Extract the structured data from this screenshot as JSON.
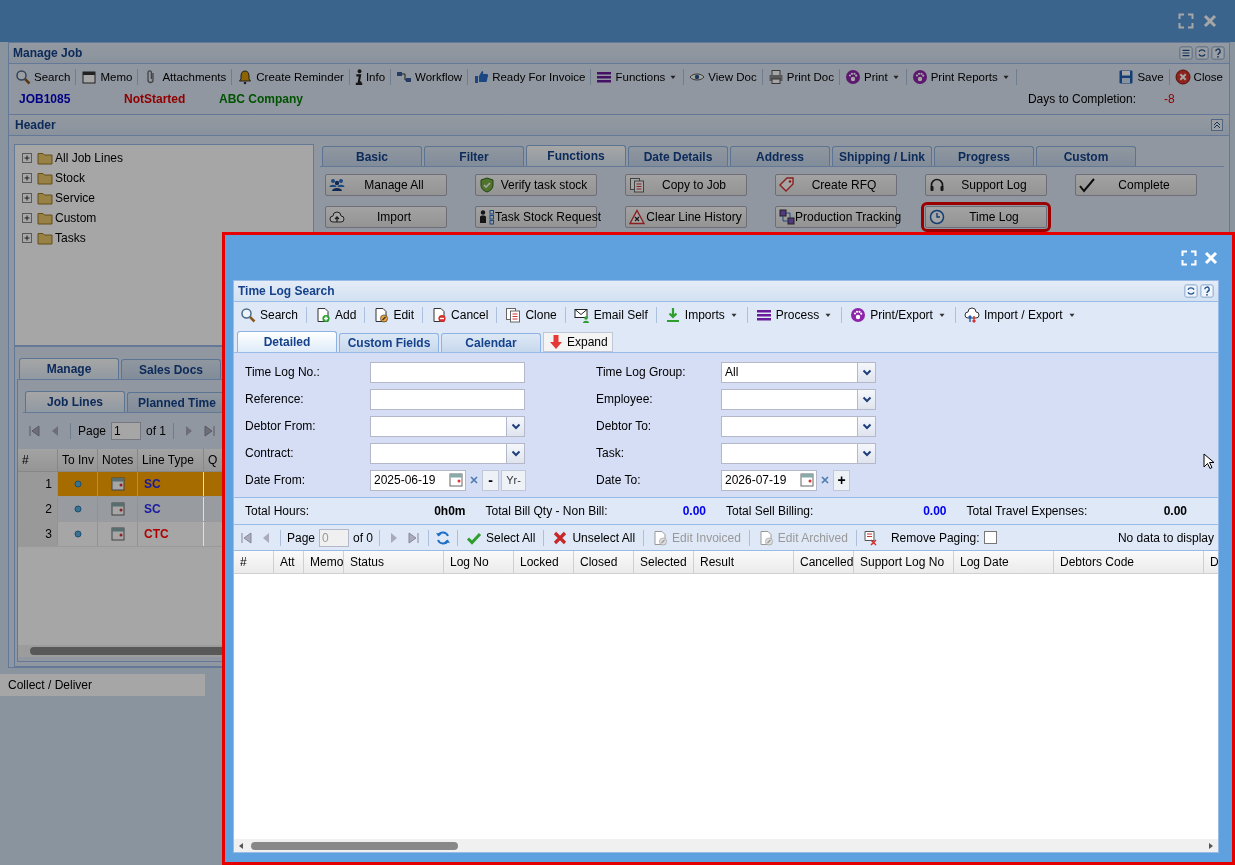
{
  "manage_job": {
    "title": "Manage Job",
    "toolbar": [
      {
        "label": "Search",
        "dropdown": false
      },
      {
        "label": "Memo",
        "dropdown": false
      },
      {
        "label": "Attachments",
        "dropdown": false
      },
      {
        "label": "Create Reminder",
        "dropdown": false
      },
      {
        "label": "Info",
        "dropdown": false
      },
      {
        "label": "Workflow",
        "dropdown": false
      },
      {
        "label": "Ready For Invoice",
        "dropdown": false
      },
      {
        "label": "Functions",
        "dropdown": true
      },
      {
        "label": "View Doc",
        "dropdown": false
      },
      {
        "label": "Print Doc",
        "dropdown": false
      },
      {
        "label": "Print",
        "dropdown": true
      },
      {
        "label": "Print Reports",
        "dropdown": true
      }
    ],
    "toolbar_right": [
      {
        "label": "Save"
      },
      {
        "label": "Close"
      }
    ],
    "job_number": "JOB1085",
    "status": "NotStarted",
    "customer": "ABC Company",
    "days_label": "Days to Completion:",
    "days_value": "-8",
    "header_title": "Header",
    "tree": [
      {
        "label": "All Job Lines",
        "expanded": false
      },
      {
        "label": "Stock",
        "expanded": false
      },
      {
        "label": "Service",
        "expanded": false
      },
      {
        "label": "Custom",
        "expanded": false
      },
      {
        "label": "Tasks",
        "expanded": false
      }
    ],
    "tabs": [
      {
        "label": "Basic",
        "selected": false
      },
      {
        "label": "Filter",
        "selected": false
      },
      {
        "label": "Functions",
        "selected": true
      },
      {
        "label": "Date Details",
        "selected": false
      },
      {
        "label": "Address",
        "selected": false
      },
      {
        "label": "Shipping / Link",
        "selected": false
      },
      {
        "label": "Progress",
        "selected": false
      },
      {
        "label": "Custom",
        "selected": false
      }
    ],
    "function_buttons": [
      {
        "label": "Manage All",
        "highlighted": false
      },
      {
        "label": "Verify task stock",
        "highlighted": false
      },
      {
        "label": "Copy to Job",
        "highlighted": false
      },
      {
        "label": "Create RFQ",
        "highlighted": false
      },
      {
        "label": "Support Log",
        "highlighted": false
      },
      {
        "label": "Complete",
        "highlighted": false
      },
      {
        "label": "Import",
        "highlighted": false
      },
      {
        "label": "Task Stock Request",
        "highlighted": false
      },
      {
        "label": "Clear Line History",
        "highlighted": false
      },
      {
        "label": "Production Tracking",
        "highlighted": false
      },
      {
        "label": "Time Log",
        "highlighted": true
      }
    ],
    "lower_tabs": [
      {
        "label": "Manage",
        "selected": true
      },
      {
        "label": "Sales Docs",
        "selected": false
      }
    ],
    "sub_tabs": [
      {
        "label": "Job Lines",
        "selected": true
      },
      {
        "label": "Planned Time",
        "selected": false
      }
    ],
    "pager": {
      "page_label": "Page",
      "page_value": "1",
      "of_label": "of 1"
    },
    "grid_columns": [
      "#",
      "To Inv",
      "Notes",
      "Line Type",
      "Q"
    ],
    "grid_rows": [
      {
        "number": "1",
        "line_type": "SC",
        "color": "#1a1aa0",
        "selected": true
      },
      {
        "number": "2",
        "line_type": "SC",
        "color": "#1a1aa0",
        "selected": false
      },
      {
        "number": "3",
        "line_type": "CTC",
        "color": "#b00000",
        "selected": false
      }
    ],
    "bottom_label": "Collect / Deliver"
  },
  "time_log": {
    "title": "Time Log Search",
    "toolbar": [
      {
        "label": "Search",
        "dropdown": false
      },
      {
        "label": "Add",
        "dropdown": false
      },
      {
        "label": "Edit",
        "dropdown": false
      },
      {
        "label": "Cancel",
        "dropdown": false
      },
      {
        "label": "Clone",
        "dropdown": false
      },
      {
        "label": "Email Self",
        "dropdown": false
      },
      {
        "label": "Imports",
        "dropdown": true
      },
      {
        "label": "Process",
        "dropdown": true
      },
      {
        "label": "Print/Export",
        "dropdown": true
      },
      {
        "label": "Import / Export",
        "dropdown": true
      }
    ],
    "tabs": [
      {
        "label": "Detailed",
        "selected": true
      },
      {
        "label": "Custom Fields",
        "selected": false
      },
      {
        "label": "Calendar",
        "selected": false
      }
    ],
    "expand_label": "Expand",
    "left_fields": [
      {
        "label": "Time Log No.:",
        "kind": "text"
      },
      {
        "label": "Reference:",
        "kind": "text"
      },
      {
        "label": "Debtor From:",
        "kind": "combo"
      },
      {
        "label": "Contract:",
        "kind": "combo"
      },
      {
        "label": "Date From:",
        "kind": "date",
        "value": "2025-06-19",
        "buttons": [
          "-",
          "Yr-"
        ]
      }
    ],
    "right_fields": [
      {
        "label": "Time Log Group:",
        "kind": "combo",
        "value": "All"
      },
      {
        "label": "Employee:",
        "kind": "combo"
      },
      {
        "label": "Debtor To:",
        "kind": "combo"
      },
      {
        "label": "Task:",
        "kind": "combo"
      },
      {
        "label": "Date To:",
        "kind": "date",
        "value": "2026-07-19",
        "buttons": [
          "+"
        ]
      }
    ],
    "totals": [
      {
        "label": "Total Hours:",
        "value": "0h0m",
        "color": "#000000"
      },
      {
        "label": "Total Bill Qty - Non Bill:",
        "value": "0.00",
        "color": "#0000ee"
      },
      {
        "label": "Total Sell Billing:",
        "value": "0.00",
        "color": "#0000ee"
      },
      {
        "label": "Total Travel Expenses:",
        "value": "0.00",
        "color": "#000000"
      }
    ],
    "pager": {
      "page_label": "Page",
      "page_value": "0",
      "of_label": "of 0"
    },
    "actions": [
      {
        "label": "Select All",
        "disabled": false
      },
      {
        "label": "Unselect All",
        "disabled": false
      },
      {
        "label": "Edit Invoiced",
        "disabled": true
      },
      {
        "label": "Edit Archived",
        "disabled": true
      }
    ],
    "remove_paging": {
      "label": "Remove Paging:",
      "checked": false
    },
    "empty_text": "No data to display",
    "columns": [
      "#",
      "Att",
      "Memo",
      "Status",
      "Log No",
      "Locked",
      "Closed",
      "Selected",
      "Result",
      "Cancelled",
      "Support Log No",
      "Log Date",
      "Debtors Code",
      "D"
    ]
  }
}
